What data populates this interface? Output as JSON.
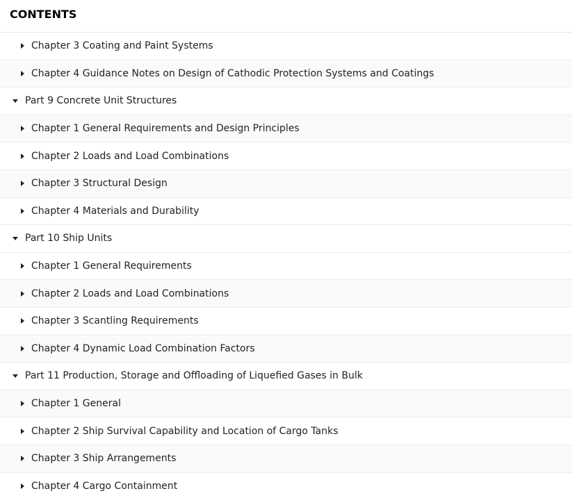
{
  "toc": {
    "title": "CONTENTS",
    "rows": [
      {
        "type": "chapter",
        "label": "Chapter 3 Coating and Paint Systems"
      },
      {
        "type": "chapter",
        "label": "Chapter 4 Guidance Notes on Design of Cathodic Protection Systems and Coatings"
      },
      {
        "type": "part",
        "label": "Part 9 Concrete Unit Structures"
      },
      {
        "type": "chapter",
        "label": "Chapter 1 General Requirements and Design Principles"
      },
      {
        "type": "chapter",
        "label": "Chapter 2 Loads and Load Combinations"
      },
      {
        "type": "chapter",
        "label": "Chapter 3 Structural Design"
      },
      {
        "type": "chapter",
        "label": "Chapter 4 Materials and Durability"
      },
      {
        "type": "part",
        "label": "Part 10 Ship Units"
      },
      {
        "type": "chapter",
        "label": "Chapter 1 General Requirements"
      },
      {
        "type": "chapter",
        "label": "Chapter 2 Loads and Load Combinations"
      },
      {
        "type": "chapter",
        "label": "Chapter 3 Scantling Requirements"
      },
      {
        "type": "chapter",
        "label": "Chapter 4 Dynamic Load Combination Factors"
      },
      {
        "type": "part",
        "label": "Part 11 Production, Storage and Offloading of Liquefied Gases in Bulk"
      },
      {
        "type": "chapter",
        "label": "Chapter 1 General"
      },
      {
        "type": "chapter",
        "label": "Chapter 2 Ship Survival Capability and Location of Cargo Tanks"
      },
      {
        "type": "chapter",
        "label": "Chapter 3 Ship Arrangements"
      },
      {
        "type": "chapter",
        "label": "Chapter 4 Cargo Containment"
      }
    ]
  },
  "icons": {
    "collapsed": "caret-right-icon",
    "expanded": "caret-down-icon"
  }
}
